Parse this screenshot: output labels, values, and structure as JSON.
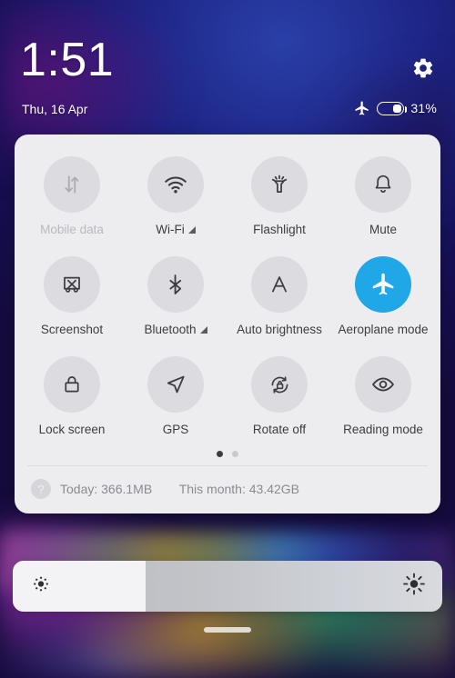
{
  "statusbar": {
    "clock": "1:51",
    "date": "Thu, 16 Apr",
    "battery_percent": "31%",
    "battery_level": 31,
    "gear_icon": "gear-icon",
    "airplane_icon": "airplane-icon"
  },
  "quick_settings": {
    "tiles": [
      {
        "label": "Mobile data",
        "icon": "mobile-data-icon",
        "state": "disabled",
        "expandable": false
      },
      {
        "label": "Wi-Fi",
        "icon": "wifi-icon",
        "state": "off",
        "expandable": true
      },
      {
        "label": "Flashlight",
        "icon": "flashlight-icon",
        "state": "off",
        "expandable": false
      },
      {
        "label": "Mute",
        "icon": "bell-icon",
        "state": "off",
        "expandable": false
      },
      {
        "label": "Screenshot",
        "icon": "screenshot-icon",
        "state": "off",
        "expandable": false
      },
      {
        "label": "Bluetooth",
        "icon": "bluetooth-icon",
        "state": "off",
        "expandable": true
      },
      {
        "label": "Auto brightness",
        "icon": "auto-brightness-icon",
        "state": "off",
        "expandable": false
      },
      {
        "label": "Aeroplane mode",
        "icon": "airplane-icon",
        "state": "active",
        "expandable": false
      },
      {
        "label": "Lock screen",
        "icon": "lock-icon",
        "state": "off",
        "expandable": false
      },
      {
        "label": "GPS",
        "icon": "location-arrow-icon",
        "state": "off",
        "expandable": false
      },
      {
        "label": "Rotate off",
        "icon": "rotate-lock-icon",
        "state": "off",
        "expandable": false
      },
      {
        "label": "Reading mode",
        "icon": "eye-icon",
        "state": "off",
        "expandable": false
      }
    ],
    "pager": {
      "count": 2,
      "active_index": 0
    },
    "data_usage": {
      "help_icon": "question-mark-icon",
      "today_label": "Today:",
      "today_value": "366.1MB",
      "month_label": "This month:",
      "month_value": "43.42GB"
    }
  },
  "brightness": {
    "value_percent": 31,
    "low_icon": "brightness-low-icon",
    "high_icon": "brightness-high-icon"
  },
  "colors": {
    "accent_active": "#20A7E8",
    "panel_background": "#EDEDF0",
    "tile_circle": "#DCDCE0",
    "icon_stroke": "#4A4A50"
  }
}
